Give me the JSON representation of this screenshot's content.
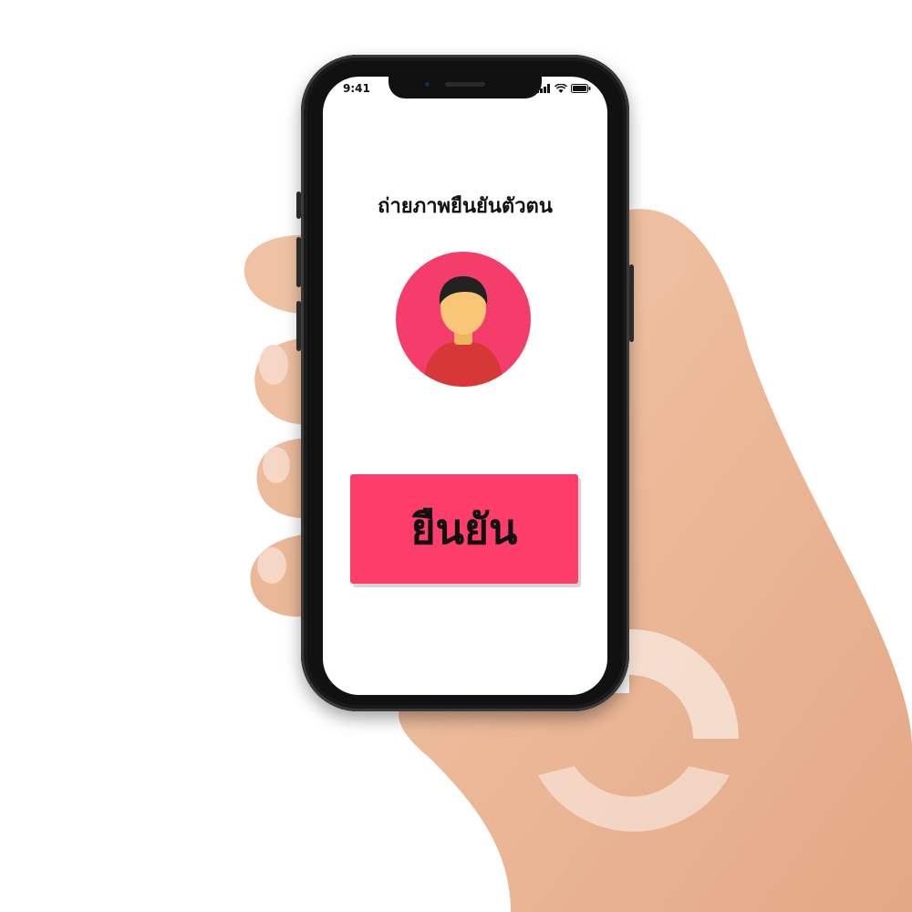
{
  "status_bar": {
    "time": "9:41",
    "icons": [
      "signal-icon",
      "wifi-icon",
      "battery-icon"
    ]
  },
  "screen": {
    "title": "ถ่ายภาพยืนยันตัวตน",
    "avatar_icon": "user-avatar-icon",
    "confirm_label": "ยืนยัน"
  },
  "colors": {
    "accent": "#ff3d6b",
    "avatar_bg": "#f53d6b",
    "shirt": "#d63838",
    "skin": "#f9c576",
    "hair": "#222222"
  }
}
